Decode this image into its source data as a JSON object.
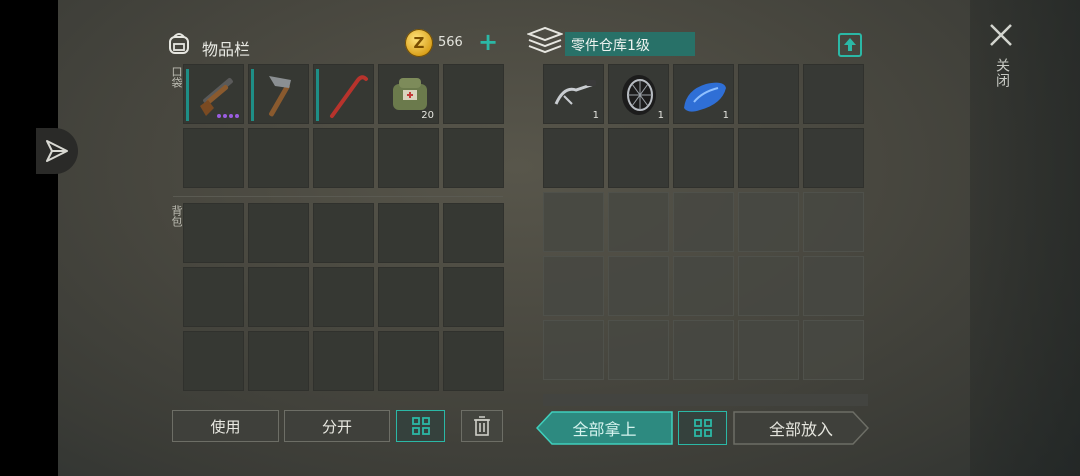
{
  "inventory": {
    "title": "物品栏",
    "coins": "566",
    "coin_symbol": "Z",
    "pocket_label": "口袋",
    "backpack_label": "背包",
    "pocket_items": [
      {
        "icon": "shotgun-icon",
        "qty": "",
        "durability_bar": true,
        "rarity_dots": 4
      },
      {
        "icon": "hatchet-icon",
        "qty": "",
        "durability_bar": true
      },
      {
        "icon": "crowbar-icon",
        "qty": "",
        "durability_bar": true
      },
      {
        "icon": "medkit-bag-icon",
        "qty": "20"
      }
    ]
  },
  "storage": {
    "title": "零件仓库1级",
    "items": [
      {
        "icon": "handlebar-icon",
        "qty": "1"
      },
      {
        "icon": "wheel-icon",
        "qty": "1"
      },
      {
        "icon": "fuel-tank-icon",
        "qty": "1"
      }
    ]
  },
  "buttons": {
    "use": "使用",
    "split": "分开",
    "take_all": "全部拿上",
    "put_all": "全部放入",
    "close": "关闭"
  },
  "colors": {
    "accent": "#2bb8a6",
    "title_box": "#287168",
    "rarity": "#9a5de0"
  }
}
